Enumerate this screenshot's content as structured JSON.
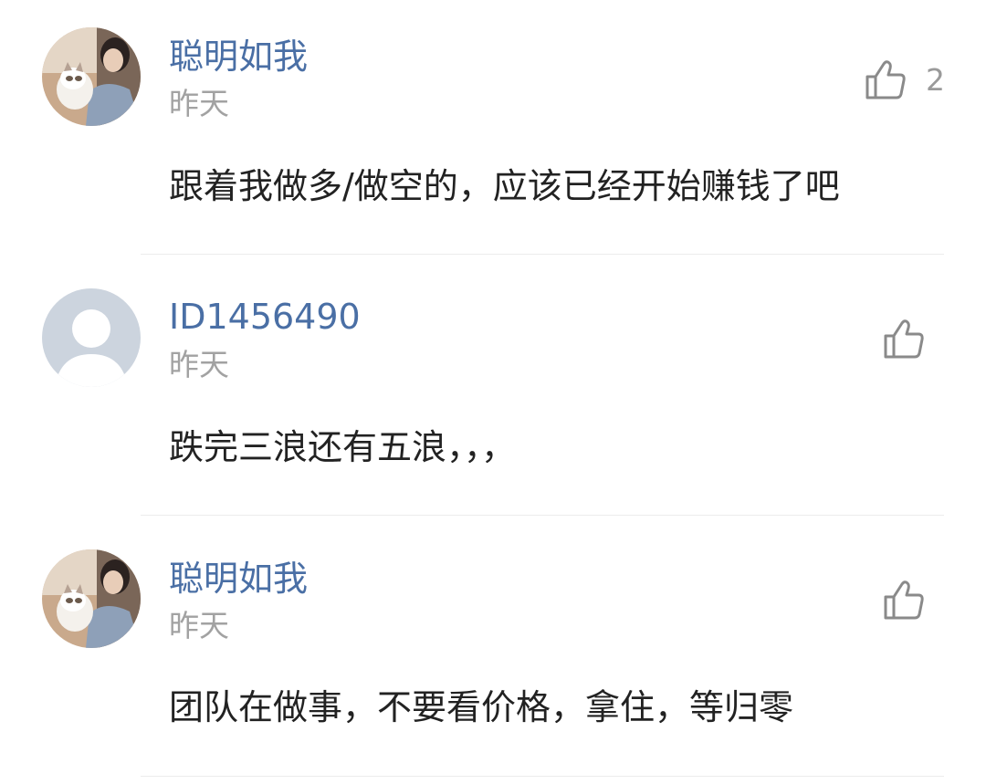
{
  "comments": [
    {
      "username": "聪明如我",
      "time": "昨天",
      "content": "跟着我做多/做空的，应该已经开始赚钱了吧",
      "likes": "2",
      "avatar": "photo-avatar"
    },
    {
      "username": "ID1456490",
      "time": "昨天",
      "content": "跌完三浪还有五浪，，，",
      "likes": "",
      "avatar": "default-avatar"
    },
    {
      "username": "聪明如我",
      "time": "昨天",
      "content": "团队在做事，不要看价格，拿住，等归零",
      "likes": "",
      "avatar": "photo-avatar"
    }
  ],
  "colors": {
    "username": "#4a6fa5",
    "time": "#a2a2a2",
    "content": "#222222",
    "divider": "#ececec",
    "icon": "#8a8a8a"
  }
}
